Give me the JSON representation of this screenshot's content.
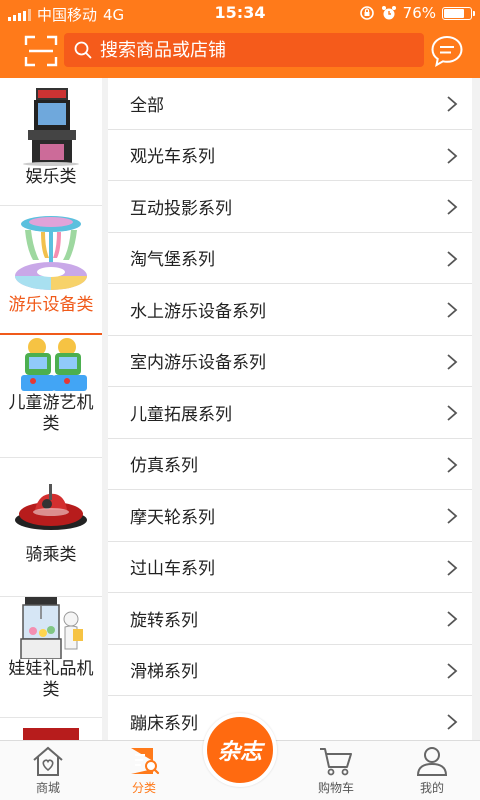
{
  "status_bar": {
    "carrier": "中国移动",
    "network": "4G",
    "time": "15:34",
    "battery": "76%",
    "battery_level": 0.76
  },
  "search": {
    "placeholder": "搜索商品或店铺"
  },
  "sidebar": {
    "items": [
      {
        "label": "娱乐类",
        "icon": "arcade-machine-image",
        "active": false
      },
      {
        "label": "游乐设备类",
        "icon": "carousel-ride-image",
        "active": true
      },
      {
        "label": "儿童游艺机类",
        "icon": "kids-game-machine-image",
        "active": false
      },
      {
        "label": "骑乘类",
        "icon": "bumper-car-image",
        "active": false
      },
      {
        "label": "娃娃礼品机类",
        "icon": "claw-machine-image",
        "active": false
      },
      {
        "label": "",
        "icon": "racing-cabinet-image",
        "active": false
      }
    ]
  },
  "subcategories": [
    "全部",
    "观光车系列",
    "互动投影系列",
    "淘气堡系列",
    "水上游乐设备系列",
    "室内游乐设备系列",
    "儿童拓展系列",
    "仿真系列",
    "摩天轮系列",
    "过山车系列",
    "旋转系列",
    "滑梯系列",
    "蹦床系列"
  ],
  "tabbar": {
    "items": [
      {
        "label": "商城",
        "icon": "home-icon",
        "active": false
      },
      {
        "label": "分类",
        "icon": "category-icon",
        "active": true
      },
      {
        "label": "杂志",
        "icon": "magazine-icon",
        "active": false
      },
      {
        "label": "购物车",
        "icon": "cart-icon",
        "active": false
      },
      {
        "label": "我的",
        "icon": "profile-icon",
        "active": false
      }
    ]
  },
  "colors": {
    "brand": "#ff7a1a",
    "search_bg": "#f55b1b",
    "active_text": "#f05a1a"
  }
}
